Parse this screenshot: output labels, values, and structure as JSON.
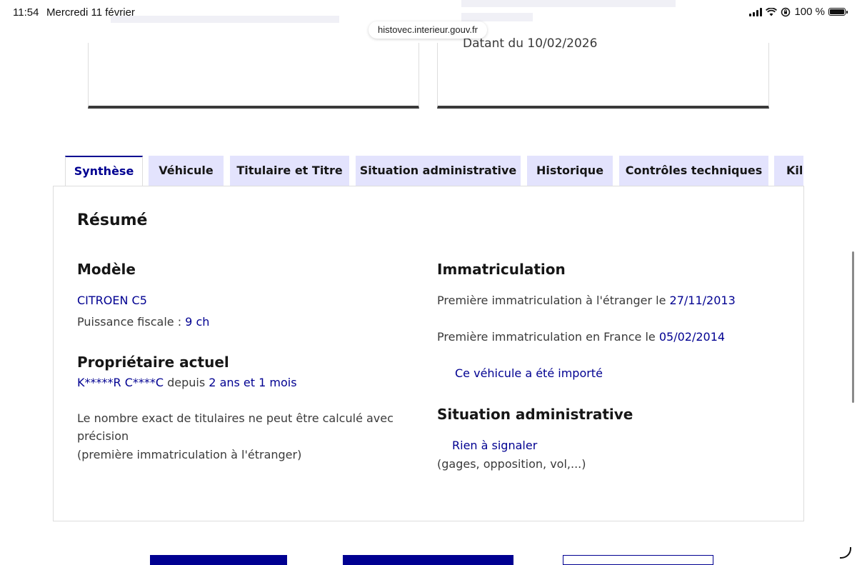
{
  "status_bar": {
    "time": "11:54",
    "date": "Mercredi 11 février",
    "battery": "100 %"
  },
  "browser": {
    "url": "histovec.interieur.gouv.fr"
  },
  "top_cards": {
    "card2_text": "Datant du 10/02/2026"
  },
  "tabs": [
    {
      "label": "Synthèse",
      "active": true
    },
    {
      "label": "Véhicule"
    },
    {
      "label": "Titulaire et Titre"
    },
    {
      "label": "Situation administrative"
    },
    {
      "label": "Historique"
    },
    {
      "label": "Contrôles techniques"
    },
    {
      "label": "Kil"
    }
  ],
  "summary": {
    "title": "Résumé",
    "model": {
      "heading": "Modèle",
      "name": "CITROEN C5",
      "power_label": "Puissance fiscale : ",
      "power_value": "9 ch"
    },
    "owner": {
      "heading": "Propriétaire actuel",
      "name": "K*****R C****C",
      "since_label": " depuis ",
      "since_value": "2 ans et 1 mois",
      "note_line1": "Le nombre exact de titulaires ne peut être calculé avec",
      "note_line2": "précision",
      "note_line3": "(première immatriculation à l'étranger)"
    },
    "registration": {
      "heading": "Immatriculation",
      "foreign_label": "Première immatriculation à l'étranger le ",
      "foreign_date": "27/11/2013",
      "france_label": "Première immatriculation en France le ",
      "france_date": "05/02/2014",
      "imported": "Ce véhicule a été importé"
    },
    "admin": {
      "heading": "Situation administrative",
      "status": "Rien à signaler",
      "detail": "(gages, opposition, vol,...)"
    }
  },
  "colors": {
    "primary_blue": "#000091",
    "tab_bg": "#e3e3fd",
    "text": "#3a3a3a"
  }
}
